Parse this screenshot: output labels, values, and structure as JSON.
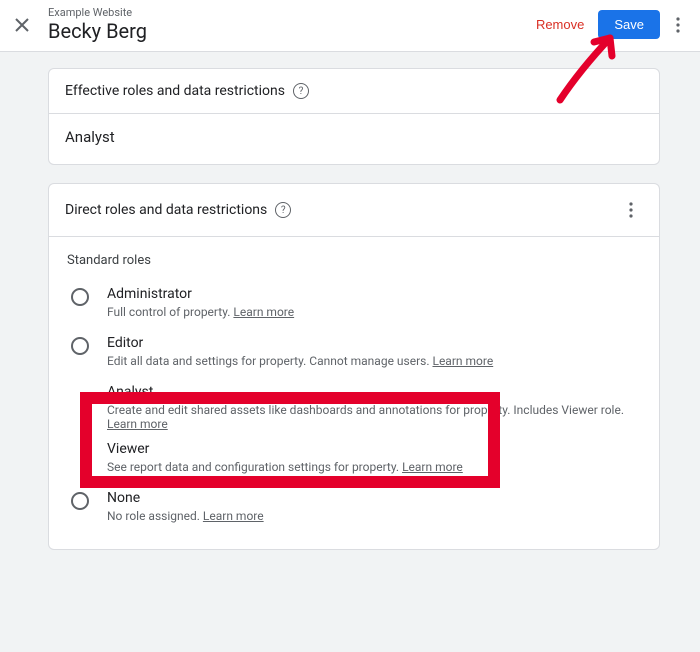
{
  "header": {
    "subtitle": "Example Website",
    "title": "Becky Berg",
    "remove": "Remove",
    "save": "Save"
  },
  "effective": {
    "heading": "Effective roles and data restrictions",
    "value": "Analyst"
  },
  "direct": {
    "heading": "Direct roles and data restrictions",
    "standard_label": "Standard roles",
    "learn_more": "Learn more",
    "roles": {
      "admin": {
        "name": "Administrator",
        "desc": "Full control of property. "
      },
      "editor": {
        "name": "Editor",
        "desc": "Edit all data and settings for property. Cannot manage users. "
      },
      "analyst": {
        "name": "Analyst",
        "desc_a": "Create and edit shared assets like dashboards and annotations for property. ",
        "desc_b": "Includes Viewer role."
      },
      "viewer": {
        "name": "Viewer",
        "desc": "See report data and configuration settings for property. "
      },
      "none": {
        "name": "None",
        "desc": "No role assigned. "
      }
    }
  }
}
